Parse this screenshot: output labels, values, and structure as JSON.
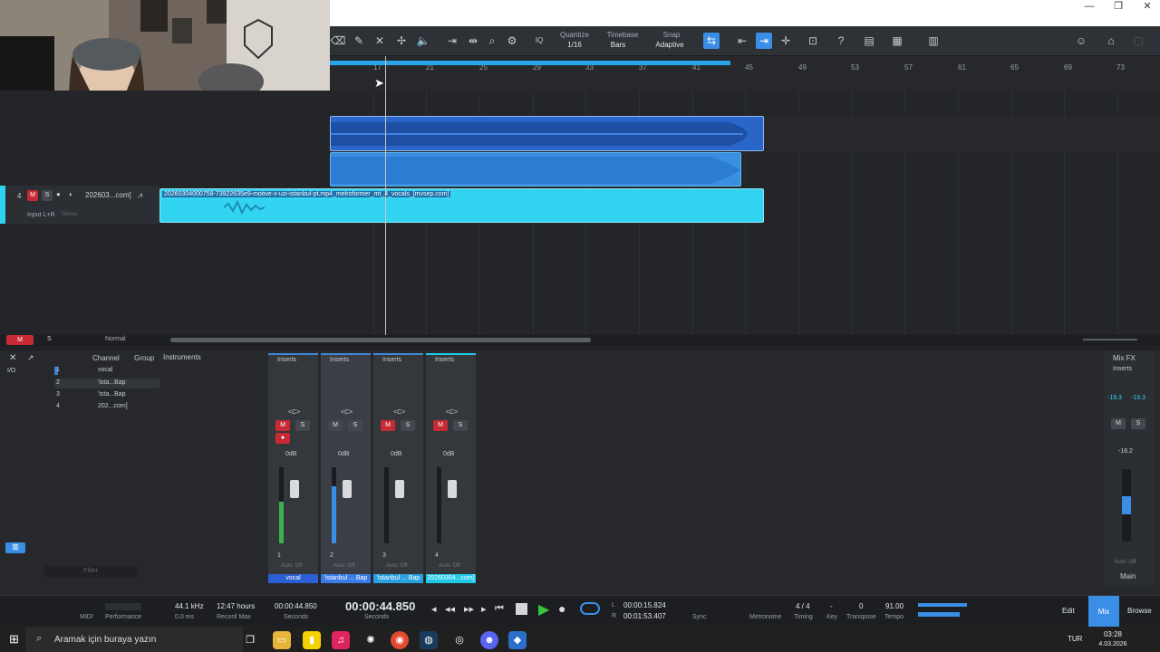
{
  "window": {
    "minimize": "—",
    "restore": "❐",
    "close": "✕"
  },
  "toolbar": {
    "quantize_label": "Quantize",
    "quantize_value": "1/16",
    "timebase_label": "Timebase",
    "timebase_value": "Bars",
    "snap_label": "Snap",
    "snap_value": "Adaptive",
    "iq": "IQ"
  },
  "ruler": {
    "bars": [
      "17",
      "21",
      "25",
      "29",
      "33",
      "37",
      "41",
      "45",
      "49",
      "53",
      "57",
      "61",
      "65",
      "69",
      "73"
    ]
  },
  "track": {
    "number": "4",
    "mute": "M",
    "solo": "S",
    "name": "202603...com]",
    "input": "Input L+R",
    "stereo": "Stereo"
  },
  "clip": {
    "name": "20260304000758-73922635e9-motive-x-uzi-istanbul-pt.mp4_melroformer_mt_4_vocals_[mvsep.com]"
  },
  "arrange_footer": {
    "m": "M",
    "s": "S",
    "mode": "Normal"
  },
  "browser": {
    "tabs": [
      "Channel",
      "Group",
      "Instruments"
    ],
    "side_labels": [
      "I/O"
    ],
    "channels": [
      {
        "num": "1",
        "name": "vocal",
        "color": "#3f7fd8"
      },
      {
        "num": "2",
        "name": "'ista...Bap",
        "color": "#4da3ff"
      },
      {
        "num": "3",
        "name": "'ista...Bap",
        "color": "#3fb0e8"
      },
      {
        "num": "4",
        "name": "202...com]",
        "color": "#2fd2f0"
      }
    ],
    "filter": "Filter"
  },
  "strips": [
    {
      "inserts": "Inserts",
      "pan": "<C>",
      "mute": "M",
      "solo": "S",
      "db": "0dB",
      "num": "1",
      "auto": "Auto: Off",
      "name": "vocal",
      "color": "#2c5fd6",
      "muted": true,
      "level": 0.55
    },
    {
      "inserts": "Inserts",
      "pan": "<C>",
      "mute": "M",
      "solo": "S",
      "db": "0dB",
      "num": "2",
      "auto": "Auto: Off",
      "name": "'istanbul ... Bap",
      "color": "#3a7be8",
      "muted": false,
      "level": 0.75
    },
    {
      "inserts": "Inserts",
      "pan": "<C>",
      "mute": "M",
      "solo": "S",
      "db": "0dB",
      "num": "3",
      "auto": "Auto: Off",
      "name": "'istanbul ... Bap",
      "color": "#2aa0e0",
      "muted": true,
      "level": 0
    },
    {
      "inserts": "Inserts",
      "pan": "<C>",
      "mute": "M",
      "solo": "S",
      "db": "0dB",
      "num": "4",
      "auto": "Auto: Off",
      "name": "20260304...com]",
      "color": "#1fc9e6",
      "muted": true,
      "level": 0
    }
  ],
  "main": {
    "mixfx": "Mix FX",
    "inserts": "Inserts",
    "peak_l": "-19.3",
    "peak_r": "-19.3",
    "mute": "M",
    "solo": "S",
    "db": "-16.2",
    "auto": "Auto: Off",
    "name": "Main"
  },
  "transport": {
    "midi": "MIDI",
    "performance": "Performance",
    "sample_rate": "44.1 kHz",
    "latency": "0.0 ms",
    "record_hours": "12:47 hours",
    "record_label": "Record Max",
    "time_small": "00:00:44.850",
    "time_small_unit": "Seconds",
    "time_big": "00:00:44.850",
    "time_big_unit": "Seconds",
    "loop_l": "L",
    "loop_start": "00:00:15.824",
    "loop_r": "R",
    "loop_end": "00:01:53.407",
    "sync": "Sync",
    "metronome": "Metronome",
    "timing_value": "4 / 4",
    "timing": "Timing",
    "key_value": "-",
    "key": "Key",
    "transpose_value": "0",
    "transpose": "Transpose",
    "tempo_value": "91.00",
    "tempo": "Tempo",
    "edit": "Edit",
    "mix": "Mix",
    "browse": "Browse"
  },
  "taskbar": {
    "search": "Aramak için buraya yazın",
    "lang": "TUR",
    "time": "03:28",
    "date": "4.03.2026"
  }
}
